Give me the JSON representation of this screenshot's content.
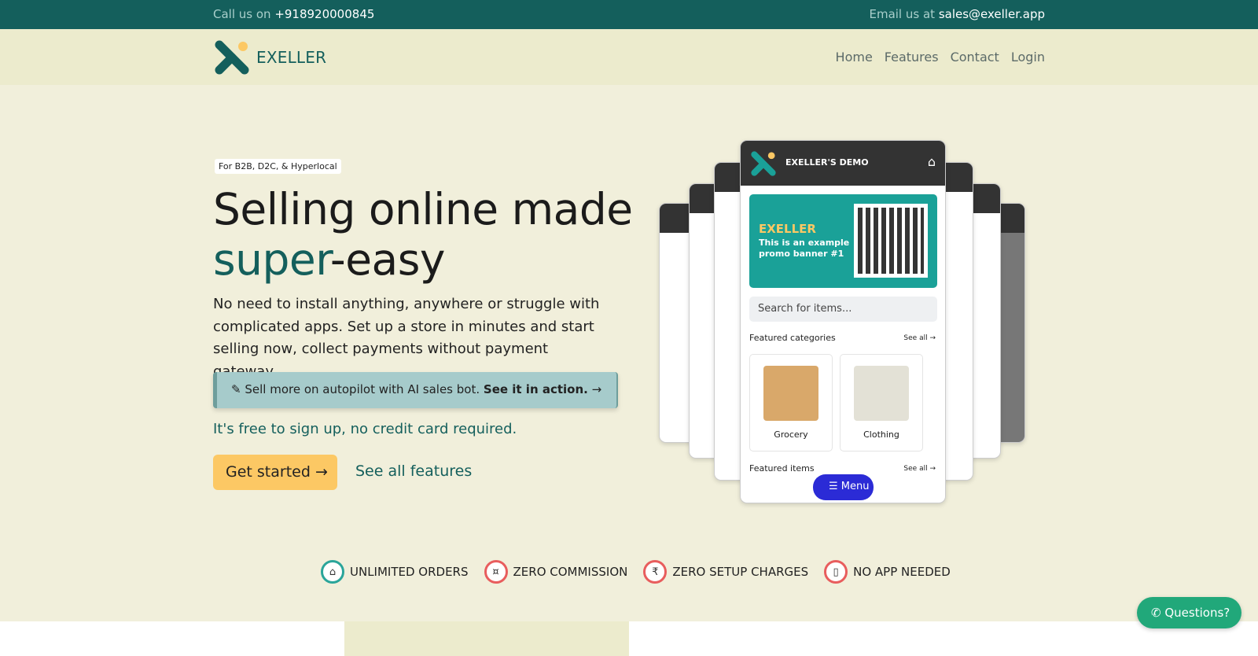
{
  "topbar": {
    "call_prefix": "Call us on ",
    "phone": "+918920000845",
    "email_prefix": "Email us at ",
    "email": "sales@exeller.app"
  },
  "nav": {
    "brand": "EXELLER",
    "links": [
      "Home",
      "Features",
      "Contact",
      "Login"
    ]
  },
  "hero": {
    "tag": "For B2B, D2C, & Hyperlocal",
    "title_line1": "Selling online made",
    "title_accent": "super",
    "title_rest": "-easy",
    "description": "No need to install anything, anywhere or struggle with complicated apps. Set up a store in minutes and start selling now, collect payments without payment gateway.",
    "ai_text": "Sell more on autopilot with AI sales bot.",
    "ai_link": "See it in action.",
    "free_text": "It's free to sign up, no credit card required.",
    "cta": "Get started",
    "features_link": "See all features"
  },
  "demo": {
    "title": "EXELLER'S DEMO",
    "banner_title": "EXELLER",
    "banner_sub": "This is an example promo banner #1",
    "search_placeholder": "Search for items...",
    "featured_categories": "Featured categories",
    "featured_items": "Featured items",
    "see_all": "See all",
    "categories": [
      "Grocery",
      "Clothing"
    ],
    "menu": "Menu"
  },
  "features": [
    "UNLIMITED ORDERS",
    "ZERO COMMISSION",
    "ZERO SETUP CHARGES",
    "NO APP NEEDED"
  ],
  "help": {
    "label": "Questions?"
  },
  "colors": {
    "brand": "#145f5c",
    "accent": "#fcc864",
    "hero_bg": "#f1efdb",
    "nav_bg": "#ecebcd"
  }
}
